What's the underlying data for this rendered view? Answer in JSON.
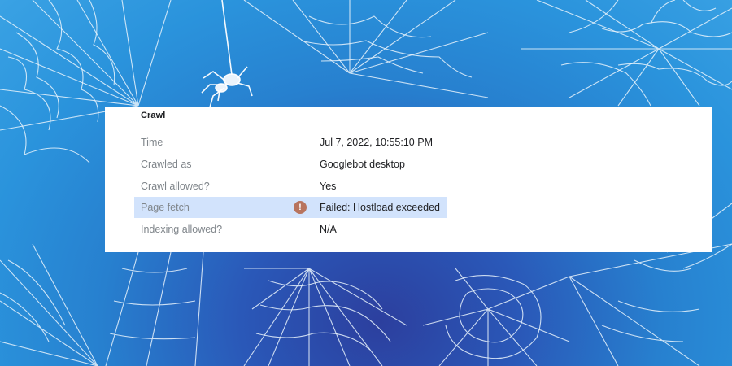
{
  "crawl": {
    "section_title": "Crawl",
    "rows": [
      {
        "label": "Time",
        "value": "Jul 7, 2022, 10:55:10 PM"
      },
      {
        "label": "Crawled as",
        "value": "Googlebot desktop"
      },
      {
        "label": "Crawl allowed?",
        "value": "Yes"
      },
      {
        "label": "Page fetch",
        "value": "Failed: Hostload exceeded",
        "status": "error",
        "icon": "error-icon"
      },
      {
        "label": "Indexing allowed?",
        "value": "N/A"
      }
    ]
  },
  "colors": {
    "highlight_row": "#d2e3fc",
    "error_icon": "#b8745e",
    "label_text": "#80868b",
    "value_text": "#202124"
  }
}
